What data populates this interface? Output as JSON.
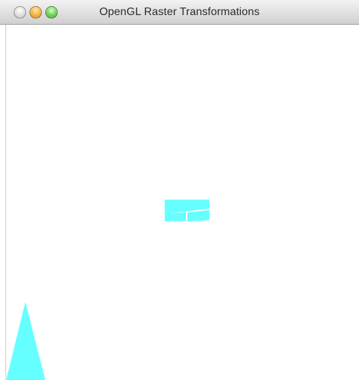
{
  "window": {
    "title": "OpenGL Raster Transformations"
  },
  "traffic_lights": [
    {
      "name": "close-button"
    },
    {
      "name": "minimize-button"
    },
    {
      "name": "zoom-button"
    }
  ],
  "canvas": {
    "background": "#ffffff",
    "fill_color": "#66ffff"
  }
}
